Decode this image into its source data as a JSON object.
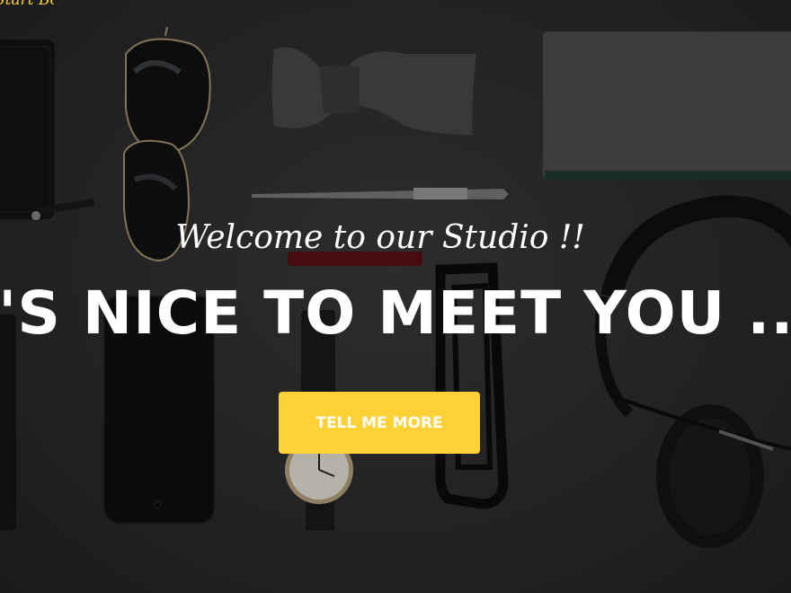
{
  "navbar": {
    "brand": "Start Bootstrap"
  },
  "hero": {
    "subheading": "Welcome to our Studio !!",
    "heading": "IT'S NICE TO MEET YOU ..",
    "cta_label": "TELL ME MORE"
  },
  "colors": {
    "accent": "#fed136",
    "text": "#ffffff",
    "background": "#2e2e2e"
  },
  "icons": [
    "wallet-icon",
    "sunglasses-icon",
    "bow-tie-icon",
    "pen-icon",
    "notebook-icon",
    "phone-icon",
    "watch-icon",
    "eyeglasses-icon",
    "headphones-icon"
  ]
}
